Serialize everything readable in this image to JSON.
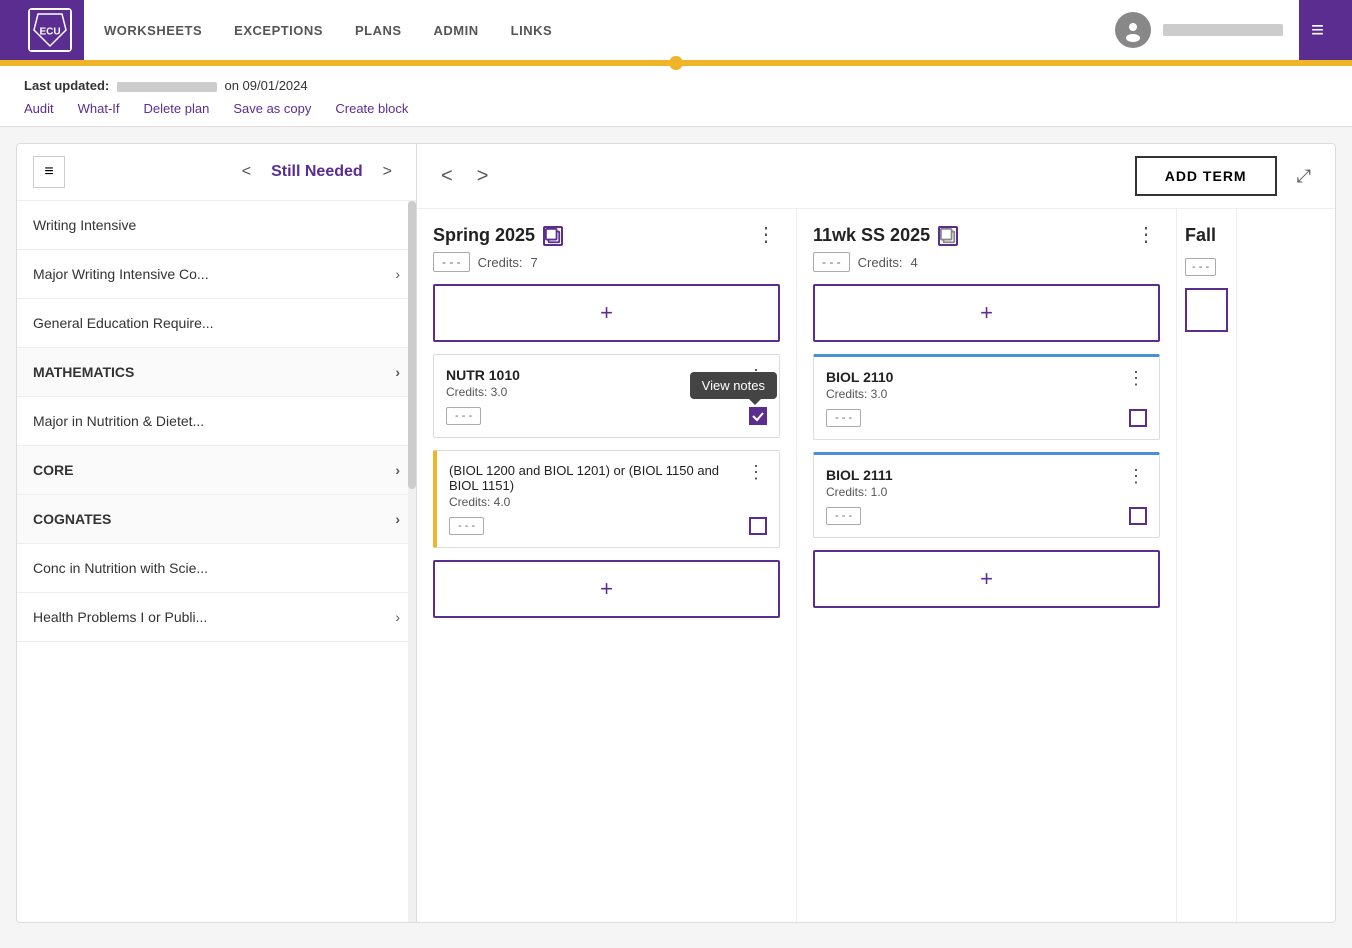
{
  "header": {
    "logo_text": "ECU",
    "nav_items": [
      "WORKSHEETS",
      "EXCEPTIONS",
      "PLANS",
      "ADMIN",
      "LINKS"
    ],
    "hamburger": "≡"
  },
  "sub_header": {
    "last_updated_label": "Last updated:",
    "date_text": "on 09/01/2024",
    "nav_links": [
      "Audit",
      "What-If",
      "Delete plan",
      "Save as copy",
      "Create block"
    ]
  },
  "left_panel": {
    "hamburger_icon": "≡",
    "nav_prev": "<",
    "nav_next": ">",
    "title": "Still Needed",
    "items": [
      {
        "label": "Writing Intensive",
        "has_arrow": false
      },
      {
        "label": "Major Writing Intensive Co...",
        "has_arrow": true
      },
      {
        "label": "General Education Require...",
        "has_arrow": false
      },
      {
        "label": "MATHEMATICS",
        "has_arrow": true
      },
      {
        "label": "Major in Nutrition & Dietet...",
        "has_arrow": false
      },
      {
        "label": "CORE",
        "has_arrow": true
      },
      {
        "label": "COGNATES",
        "has_arrow": true
      },
      {
        "label": "Conc in Nutrition with Scie...",
        "has_arrow": false
      },
      {
        "label": "Health Problems I or Publi...",
        "has_arrow": true
      }
    ]
  },
  "right_panel": {
    "nav_prev": "<",
    "nav_next": ">",
    "add_term_label": "ADD TERM",
    "terms": [
      {
        "id": "spring2025",
        "title": "Spring 2025",
        "has_copy_icon": true,
        "credits_label": "Credits:",
        "credits_value": "7",
        "courses": [
          {
            "id": "nutr1010",
            "name": "NUTR 1010",
            "credits": "Credits: 3.0",
            "badge": "- - -",
            "checked": true,
            "has_tooltip": true,
            "tooltip_text": "View notes",
            "blue_top": false,
            "orange_left": false
          },
          {
            "id": "biol_combo",
            "name": "(BIOL 1200 and BIOL 1201) or (BIOL 1150 and BIOL 1151)",
            "credits": "Credits: 4.0",
            "badge": "- - -",
            "checked": false,
            "has_tooltip": false,
            "blue_top": false,
            "orange_left": true
          }
        ]
      },
      {
        "id": "ss2025",
        "title": "11wk SS 2025",
        "has_copy_icon": true,
        "credits_label": "Credits:",
        "credits_value": "4",
        "courses": [
          {
            "id": "biol2110",
            "name": "BIOL 2110",
            "credits": "Credits: 3.0",
            "badge": "- - -",
            "checked": false,
            "has_tooltip": false,
            "blue_top": true,
            "orange_left": false
          },
          {
            "id": "biol2111",
            "name": "BIOL 2111",
            "credits": "Credits: 1.0",
            "badge": "- - -",
            "checked": false,
            "has_tooltip": false,
            "blue_top": true,
            "orange_left": false
          }
        ]
      },
      {
        "id": "fall",
        "title": "Fall",
        "has_copy_icon": false,
        "credits_label": "",
        "credits_value": "",
        "courses": []
      }
    ],
    "expand_icon": "⤢"
  }
}
